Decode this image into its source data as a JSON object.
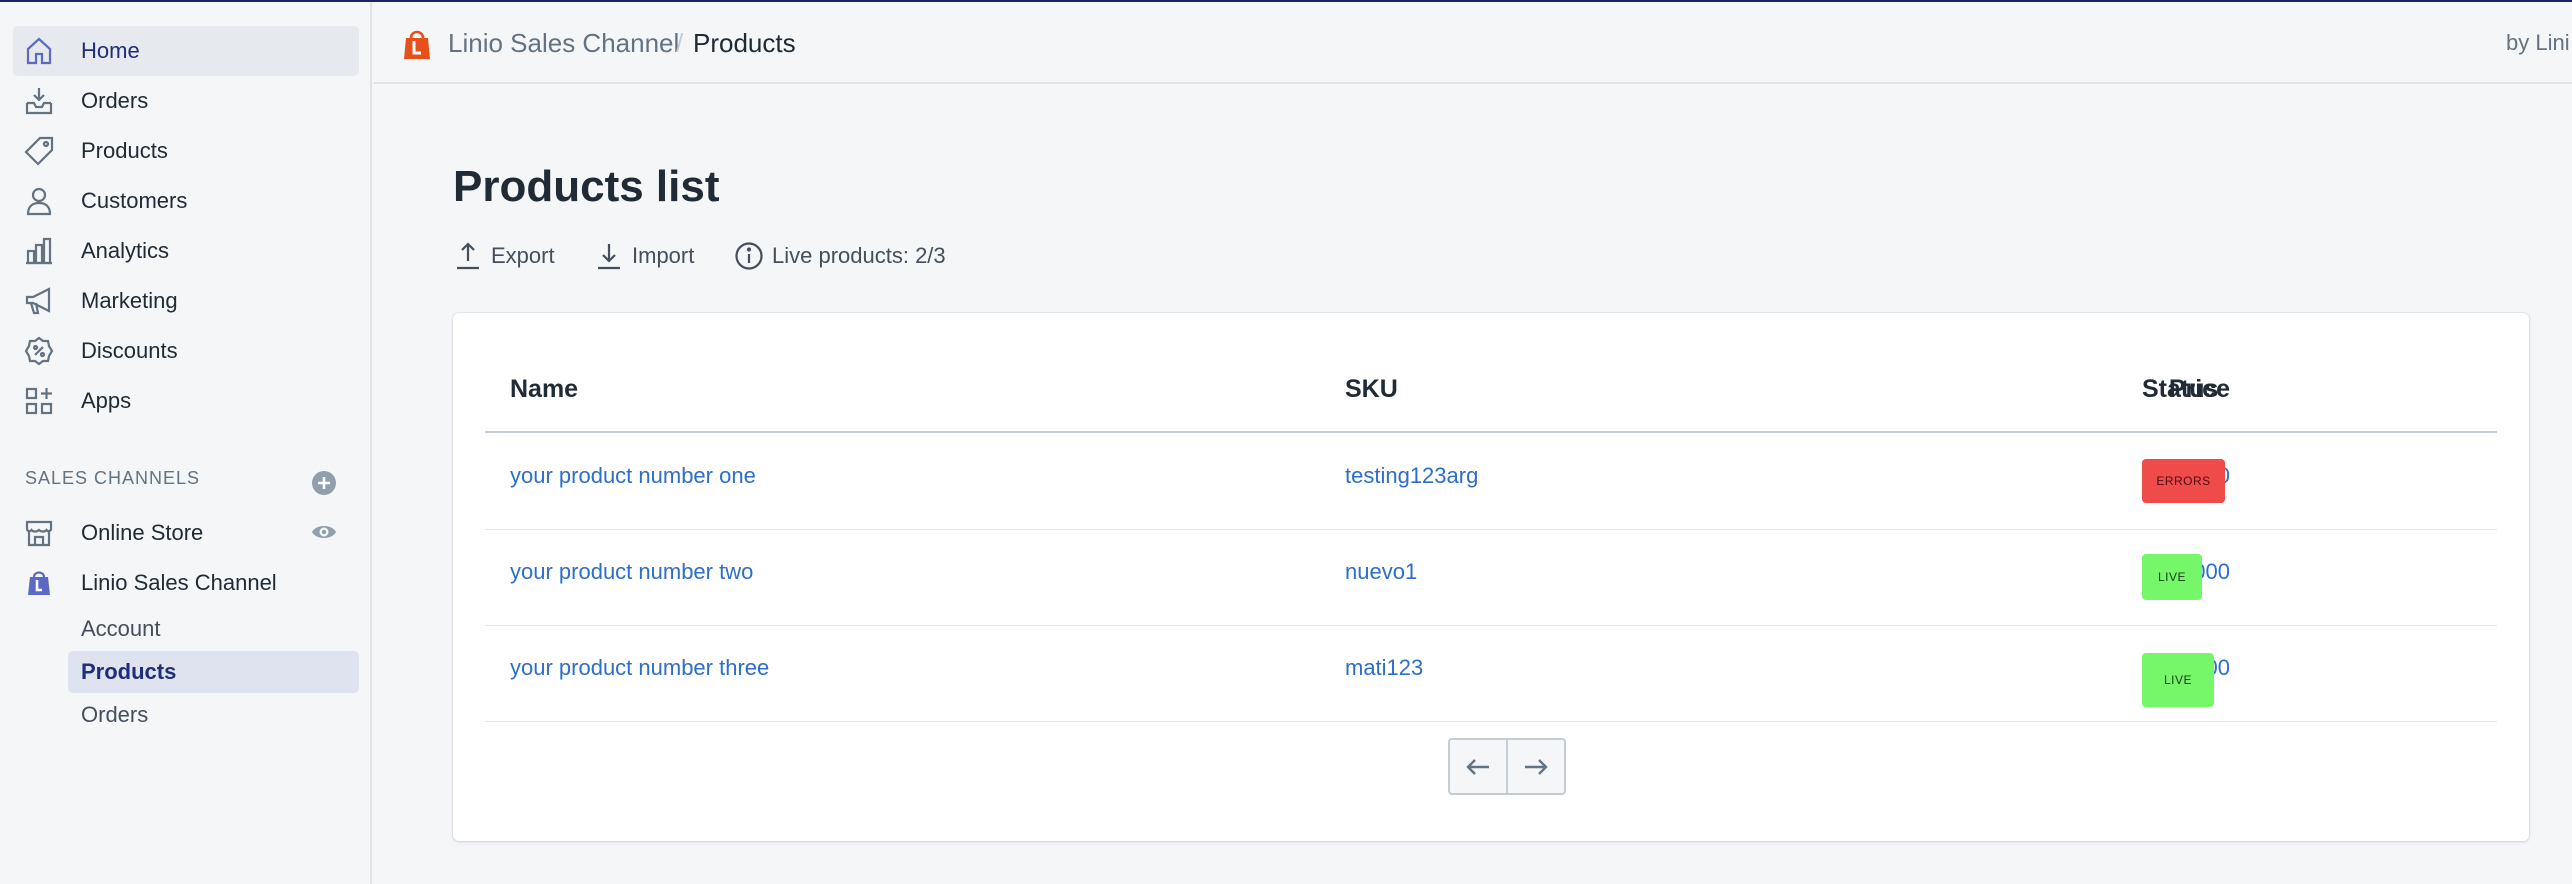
{
  "sidebar": {
    "items": [
      {
        "label": "Home",
        "icon": "home-icon"
      },
      {
        "label": "Orders",
        "icon": "inbox-download-icon"
      },
      {
        "label": "Products",
        "icon": "tag-icon"
      },
      {
        "label": "Customers",
        "icon": "person-icon"
      },
      {
        "label": "Analytics",
        "icon": "bar-chart-icon"
      },
      {
        "label": "Marketing",
        "icon": "megaphone-icon"
      },
      {
        "label": "Discounts",
        "icon": "discount-badge-icon"
      },
      {
        "label": "Apps",
        "icon": "apps-grid-icon"
      }
    ],
    "sales_channels_title": "SALES CHANNELS",
    "channels": [
      {
        "label": "Online Store",
        "icon": "store-icon"
      },
      {
        "label": "Linio Sales Channel",
        "icon": "linio-bag-icon"
      }
    ],
    "sub_items": [
      {
        "label": "Account"
      },
      {
        "label": "Products"
      },
      {
        "label": "Orders"
      }
    ]
  },
  "header": {
    "breadcrumb_parent": "Linio Sales Channel",
    "breadcrumb_separator": "/",
    "breadcrumb_current": "Products",
    "byline": "by Lini"
  },
  "main": {
    "title": "Products list",
    "actions": {
      "export": "Export",
      "import": "Import",
      "live_products": "Live products: 2/3"
    },
    "table": {
      "columns": [
        "Name",
        "SKU",
        "Price",
        "Status"
      ],
      "rows": [
        {
          "name": "your product number one",
          "sku": "testing123arg",
          "price": "900",
          "status": "ERRORS"
        },
        {
          "name": "your product number two",
          "sku": "nuevo1",
          "price": "1000",
          "status": "LIVE"
        },
        {
          "name": "your product number three",
          "sku": "mati123",
          "price": "123.00",
          "status": "LIVE"
        }
      ]
    }
  },
  "colors": {
    "accent": "#202e78",
    "link": "#2c6ecb",
    "status_errors": "#ef4b4b",
    "status_live": "#76f76a",
    "brand_logo": "#e8501b"
  }
}
